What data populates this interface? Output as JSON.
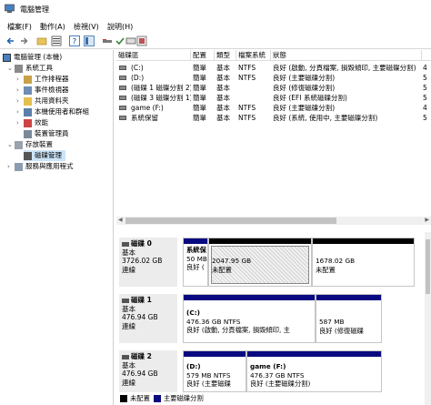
{
  "window": {
    "title": "電腦管理"
  },
  "menu": [
    "檔案(F)",
    "動作(A)",
    "檢視(V)",
    "說明(H)"
  ],
  "toolbar": [
    "back-icon",
    "forward-icon",
    "up-folder-icon",
    "properties-icon",
    "help-icon",
    "view-icon",
    "refresh-icon",
    "checkmark-icon",
    "drive-icon",
    "settings-icon"
  ],
  "tree": {
    "root": "電腦管理 (本機)",
    "system_tools": "系統工具",
    "task_scheduler": "工作排程器",
    "event_viewer": "事件檢視器",
    "shared_folders": "共用資料夾",
    "local_users": "本機使用者和群組",
    "performance": "效能",
    "device_manager": "裝置管理員",
    "storage": "存放裝置",
    "disk_management": "磁碟管理",
    "services": "服務與應用程式"
  },
  "volume_table": {
    "headers": [
      "磁碟區",
      "配置",
      "類型",
      "檔案系統",
      "狀態"
    ],
    "rows": [
      [
        "(C:)",
        "簡單",
        "基本",
        "NTFS",
        "良好 (啟動, 分頁檔案, 損毀傾印, 主要磁碟分割)",
        "4"
      ],
      [
        "(D:)",
        "簡單",
        "基本",
        "NTFS",
        "良好 (主要磁碟分割)",
        "5"
      ],
      [
        "(磁碟 1 磁碟分割 2)",
        "簡單",
        "基本",
        "",
        "良好 (修復磁碟分割)",
        "5"
      ],
      [
        "(磁碟 3 磁碟分割 1)",
        "簡單",
        "基本",
        "",
        "良好 (EFI 系統磁碟分割)",
        "5"
      ],
      [
        "game (F:)",
        "簡單",
        "基本",
        "NTFS",
        "良好 (主要磁碟分割)",
        "4"
      ],
      [
        "系統保留",
        "簡單",
        "基本",
        "NTFS",
        "良好 (系統, 使用中, 主要磁碟分割)",
        "5"
      ]
    ]
  },
  "disks": [
    {
      "name": "磁碟 0",
      "type": "基本",
      "size": "3726.02 GB",
      "status": "連線",
      "partitions": [
        {
          "line1": "系統保",
          "line2": "50 MB",
          "line3": "良好 (",
          "kind": "primary"
        },
        {
          "line1": "",
          "line2": "2047.95 GB",
          "line3": "未配置",
          "kind": "unallocated"
        },
        {
          "line1": "",
          "line2": "1678.02 GB",
          "line3": "未配置",
          "kind": "unallocated-black"
        }
      ]
    },
    {
      "name": "磁碟 1",
      "type": "基本",
      "size": "476.94 GB",
      "status": "連線",
      "partitions": [
        {
          "line1": "(C:)",
          "line2": "476.36 GB NTFS",
          "line3": "良好 (啟動, 分頁檔案, 損毀傾印, 主",
          "kind": "primary"
        },
        {
          "line1": "",
          "line2": "587 MB",
          "line3": "良好 (修復磁碟",
          "kind": "primary"
        }
      ]
    },
    {
      "name": "磁碟 2",
      "type": "基本",
      "size": "476.94 GB",
      "status": "連線",
      "partitions": [
        {
          "line1": "(D:)",
          "line2": "579 MB NTFS",
          "line3": "良好 (主要磁碟",
          "kind": "primary"
        },
        {
          "line1": "game  (F:)",
          "line2": "476.37 GB NTFS",
          "line3": "良好 (主要磁碟分割)",
          "kind": "primary"
        }
      ]
    }
  ],
  "legend": {
    "unallocated": "未配置",
    "primary": "主要磁碟分割"
  },
  "colors": {
    "primary_bar": "#0a0a80",
    "unallocated_bar": "#000000",
    "selection": "#cce4f7"
  }
}
